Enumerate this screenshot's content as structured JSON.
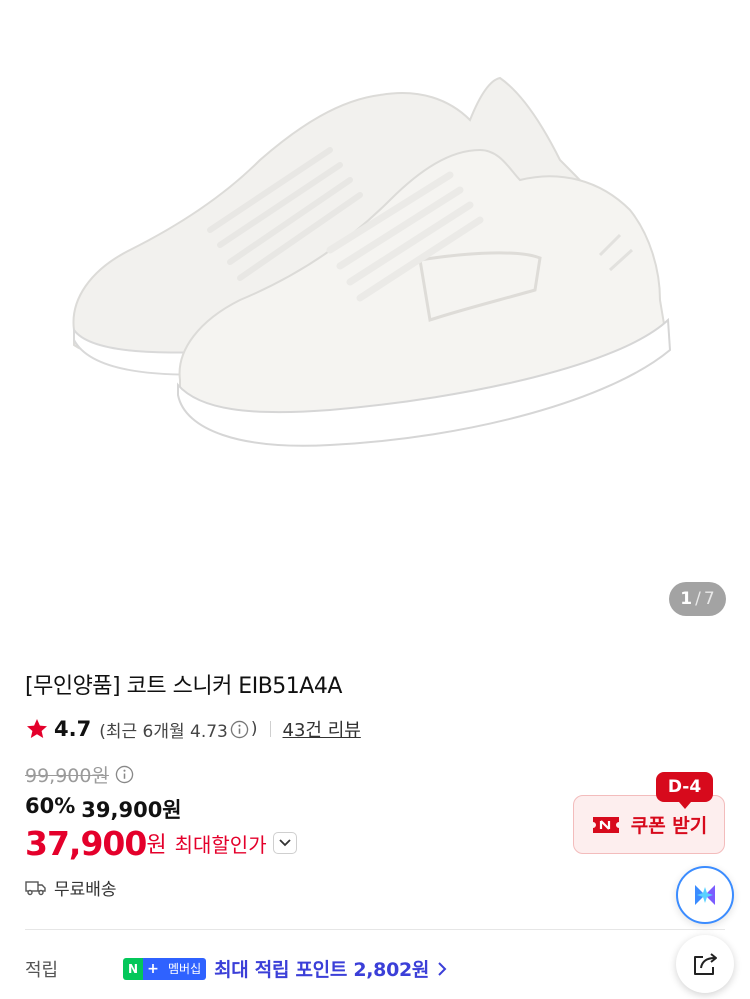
{
  "gallery": {
    "current": "1",
    "separator": "/",
    "total": "7",
    "image_icon": "sneaker-product-image"
  },
  "product": {
    "title": "[무인양품] 코트 스니커 EIB51A4A"
  },
  "rating": {
    "score": "4.7",
    "recent": "(최근 6개월 4.73",
    "recent_close": ")",
    "reviews": "43건 리뷰"
  },
  "price": {
    "original": "99,900원",
    "discount_rate": "60%",
    "sale_price": "39,900원",
    "final_number": "37,900",
    "final_unit": "원",
    "final_label": "최대할인가"
  },
  "coupon": {
    "badge": "D-4",
    "label": "쿠폰 받기",
    "logo": "N"
  },
  "shipping": {
    "label": "무료배송"
  },
  "points": {
    "label": "적립",
    "badge_n": "N",
    "badge_plus": "+",
    "badge_text": "멤버십",
    "text": "최대 적립 포인트 2,802원"
  },
  "colors": {
    "accent_red": "#e4002b",
    "coupon_red": "#d70a1c",
    "points_blue": "#3b3fd8",
    "naver_green": "#04c75a"
  }
}
